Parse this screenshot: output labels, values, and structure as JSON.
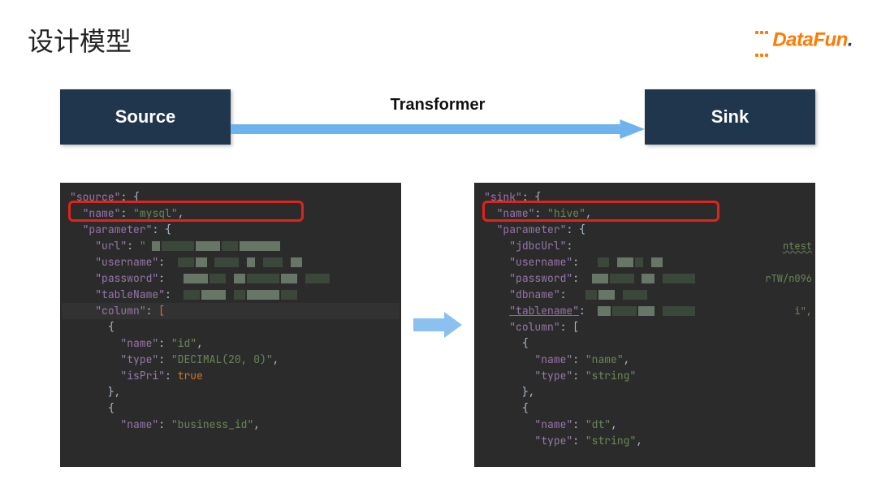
{
  "title": "设计模型",
  "logo": {
    "text": "DataFun",
    "period": "."
  },
  "flow": {
    "source_label": "Source",
    "transformer_label": "Transformer",
    "sink_label": "Sink"
  },
  "source_code": {
    "root_key": "source",
    "name_key": "name",
    "name_val": "mysql",
    "parameter_key": "parameter",
    "url_key": "url",
    "username_key": "username",
    "password_key": "password",
    "tablename_key": "tableName",
    "column_key": "column",
    "col1_name_key": "name",
    "col1_name_val": "id",
    "col1_type_key": "type",
    "col1_type_val": "DECIMAL(20, 0)",
    "col1_ispri_key": "isPri",
    "col1_ispri_val": "true",
    "col2_name_key": "name",
    "col2_name_val": "business_id"
  },
  "sink_code": {
    "root_key": "sink",
    "name_key": "name",
    "name_val": "hive",
    "parameter_key": "parameter",
    "jdbcurl_key": "jdbcUrl",
    "jdbcurl_hint": "ntest",
    "username_key": "username",
    "password_key": "password",
    "password_hint": "rTW/n096",
    "dbname_key": "dbname",
    "tablename_key": "tablename",
    "tablename_hint": "i\",",
    "column_key": "column",
    "col1_name_key": "name",
    "col1_name_val": "name",
    "col1_type_key": "type",
    "col1_type_val": "string",
    "col2_name_key": "name",
    "col2_name_val": "dt",
    "col2_type_key": "type",
    "col2_type_val": "string"
  }
}
